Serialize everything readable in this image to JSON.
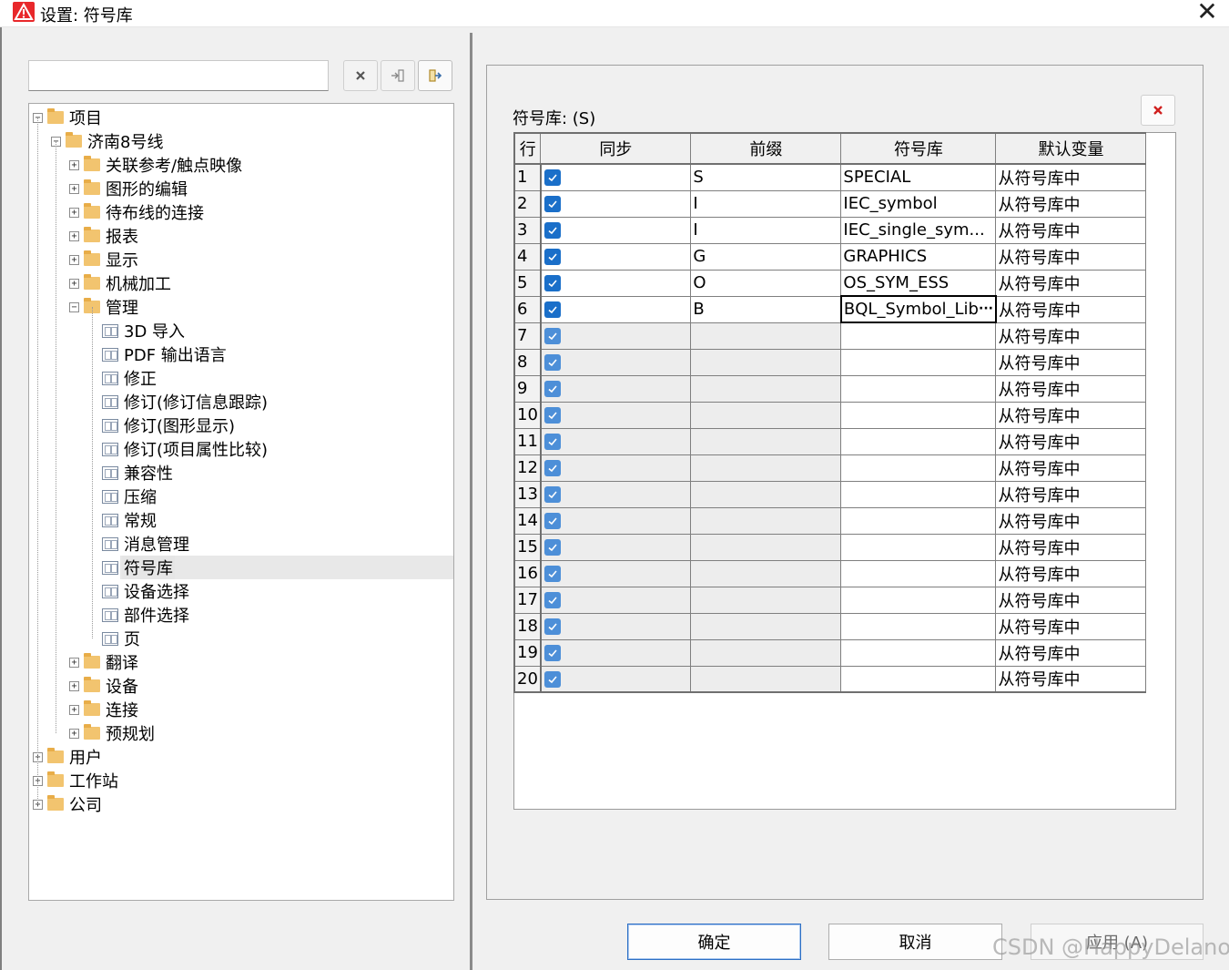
{
  "window": {
    "title": "设置: 符号库",
    "close_glyph": "✕",
    "accent": "#e8282b"
  },
  "search": {
    "value": "",
    "placeholder": ""
  },
  "toolbar": {
    "clear_icon": "x-icon",
    "import_icon": "import-icon",
    "export_icon": "export-icon"
  },
  "tree": {
    "nodes": [
      {
        "label": "项目",
        "level": 0,
        "type": "folder",
        "expanded": true
      },
      {
        "label": "济南8号线",
        "level": 1,
        "type": "folder",
        "expanded": true
      },
      {
        "label": "关联参考/触点映像",
        "level": 2,
        "type": "folder",
        "expanded": false
      },
      {
        "label": "图形的编辑",
        "level": 2,
        "type": "folder",
        "expanded": false
      },
      {
        "label": "待布线的连接",
        "level": 2,
        "type": "folder",
        "expanded": false
      },
      {
        "label": "报表",
        "level": 2,
        "type": "folder",
        "expanded": false
      },
      {
        "label": "显示",
        "level": 2,
        "type": "folder",
        "expanded": false
      },
      {
        "label": "机械加工",
        "level": 2,
        "type": "folder",
        "expanded": false
      },
      {
        "label": "管理",
        "level": 2,
        "type": "folder",
        "expanded": true
      },
      {
        "label": "3D 导入",
        "level": 3,
        "type": "page"
      },
      {
        "label": "PDF 输出语言",
        "level": 3,
        "type": "page"
      },
      {
        "label": "修正",
        "level": 3,
        "type": "page"
      },
      {
        "label": "修订(修订信息跟踪)",
        "level": 3,
        "type": "page"
      },
      {
        "label": "修订(图形显示)",
        "level": 3,
        "type": "page"
      },
      {
        "label": "修订(项目属性比较)",
        "level": 3,
        "type": "page"
      },
      {
        "label": "兼容性",
        "level": 3,
        "type": "page"
      },
      {
        "label": "压缩",
        "level": 3,
        "type": "page"
      },
      {
        "label": "常规",
        "level": 3,
        "type": "page"
      },
      {
        "label": "消息管理",
        "level": 3,
        "type": "page"
      },
      {
        "label": "符号库",
        "level": 3,
        "type": "page",
        "selected": true
      },
      {
        "label": "设备选择",
        "level": 3,
        "type": "page"
      },
      {
        "label": "部件选择",
        "level": 3,
        "type": "page"
      },
      {
        "label": "页",
        "level": 3,
        "type": "page"
      },
      {
        "label": "翻译",
        "level": 2,
        "type": "folder",
        "expanded": false
      },
      {
        "label": "设备",
        "level": 2,
        "type": "folder",
        "expanded": false
      },
      {
        "label": "连接",
        "level": 2,
        "type": "folder",
        "expanded": false
      },
      {
        "label": "预规划",
        "level": 2,
        "type": "folder",
        "expanded": false
      },
      {
        "label": "用户",
        "level": 0,
        "type": "folder",
        "expanded": false
      },
      {
        "label": "工作站",
        "level": 0,
        "type": "folder",
        "expanded": false
      },
      {
        "label": "公司",
        "level": 0,
        "type": "folder",
        "expanded": false
      }
    ]
  },
  "grid": {
    "label": "符号库: (S)",
    "columns": [
      "行",
      "同步",
      "前缀",
      "符号库",
      "默认变量"
    ],
    "rows": [
      {
        "row": "1",
        "sync": true,
        "prefix": "S",
        "library": "SPECIAL",
        "variant": "从符号库中"
      },
      {
        "row": "2",
        "sync": true,
        "prefix": "I",
        "library": "IEC_symbol",
        "variant": "从符号库中"
      },
      {
        "row": "3",
        "sync": true,
        "prefix": "I",
        "library": "IEC_single_sym...",
        "variant": "从符号库中"
      },
      {
        "row": "4",
        "sync": true,
        "prefix": "G",
        "library": "GRAPHICS",
        "variant": "从符号库中"
      },
      {
        "row": "5",
        "sync": true,
        "prefix": "O",
        "library": "OS_SYM_ESS",
        "variant": "从符号库中"
      },
      {
        "row": "6",
        "sync": true,
        "prefix": "B",
        "library": "BQL_Symbol_Lib",
        "variant": "从符号库中",
        "editing": true
      },
      {
        "row": "7",
        "sync": true,
        "prefix": "",
        "library": "",
        "variant": "从符号库中"
      },
      {
        "row": "8",
        "sync": true,
        "prefix": "",
        "library": "",
        "variant": "从符号库中"
      },
      {
        "row": "9",
        "sync": true,
        "prefix": "",
        "library": "",
        "variant": "从符号库中"
      },
      {
        "row": "10",
        "sync": true,
        "prefix": "",
        "library": "",
        "variant": "从符号库中"
      },
      {
        "row": "11",
        "sync": true,
        "prefix": "",
        "library": "",
        "variant": "从符号库中"
      },
      {
        "row": "12",
        "sync": true,
        "prefix": "",
        "library": "",
        "variant": "从符号库中"
      },
      {
        "row": "13",
        "sync": true,
        "prefix": "",
        "library": "",
        "variant": "从符号库中"
      },
      {
        "row": "14",
        "sync": true,
        "prefix": "",
        "library": "",
        "variant": "从符号库中"
      },
      {
        "row": "15",
        "sync": true,
        "prefix": "",
        "library": "",
        "variant": "从符号库中"
      },
      {
        "row": "16",
        "sync": true,
        "prefix": "",
        "library": "",
        "variant": "从符号库中"
      },
      {
        "row": "17",
        "sync": true,
        "prefix": "",
        "library": "",
        "variant": "从符号库中"
      },
      {
        "row": "18",
        "sync": true,
        "prefix": "",
        "library": "",
        "variant": "从符号库中"
      },
      {
        "row": "19",
        "sync": true,
        "prefix": "",
        "library": "",
        "variant": "从符号库中"
      },
      {
        "row": "20",
        "sync": true,
        "prefix": "",
        "library": "",
        "variant": "从符号库中"
      }
    ],
    "ellipsis_glyph": "···"
  },
  "buttons": {
    "ok": "确定",
    "cancel": "取消",
    "apply": "应用 (A)"
  },
  "watermark": "CSDN @HappyDelano"
}
